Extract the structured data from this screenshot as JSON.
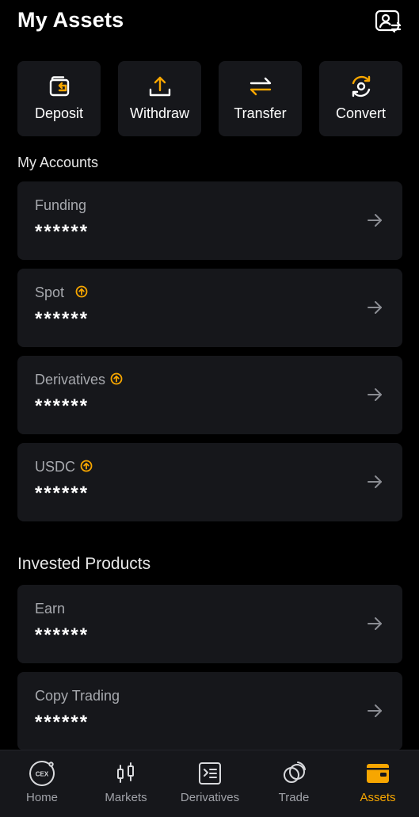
{
  "header": {
    "title": "My Assets",
    "profile_icon": "profile-switch-icon"
  },
  "quick_actions": [
    {
      "label": "Deposit",
      "icon": "wallet-deposit-icon"
    },
    {
      "label": "Withdraw",
      "icon": "upload-icon"
    },
    {
      "label": "Transfer",
      "icon": "swap-arrows-icon"
    },
    {
      "label": "Convert",
      "icon": "convert-icon"
    }
  ],
  "accounts": {
    "title": "My Accounts",
    "items": [
      {
        "label": "Funding",
        "value": "******",
        "upgrade_badge": false
      },
      {
        "label": "Spot",
        "value": "******",
        "upgrade_badge": true
      },
      {
        "label": "Derivatives",
        "value": "******",
        "upgrade_badge": true
      },
      {
        "label": "USDC",
        "value": "******",
        "upgrade_badge": true
      }
    ]
  },
  "invested": {
    "title": "Invested Products",
    "items": [
      {
        "label": "Earn",
        "value": "******"
      },
      {
        "label": "Copy Trading",
        "value": "******"
      }
    ]
  },
  "tabbar": {
    "items": [
      {
        "label": "Home",
        "icon": "cex-home-icon",
        "active": false
      },
      {
        "label": "Markets",
        "icon": "candlestick-icon",
        "active": false
      },
      {
        "label": "Derivatives",
        "icon": "derivatives-icon",
        "active": false
      },
      {
        "label": "Trade",
        "icon": "trade-icon",
        "active": false
      },
      {
        "label": "Assets",
        "icon": "wallet-icon",
        "active": true
      }
    ],
    "cex_text": "CEX"
  },
  "colors": {
    "background": "#000000",
    "card": "#16171b",
    "accent": "#f7a600",
    "text_primary": "#ffffff",
    "text_secondary": "#a7a9ae",
    "tab_inactive": "#a0a2a8"
  }
}
